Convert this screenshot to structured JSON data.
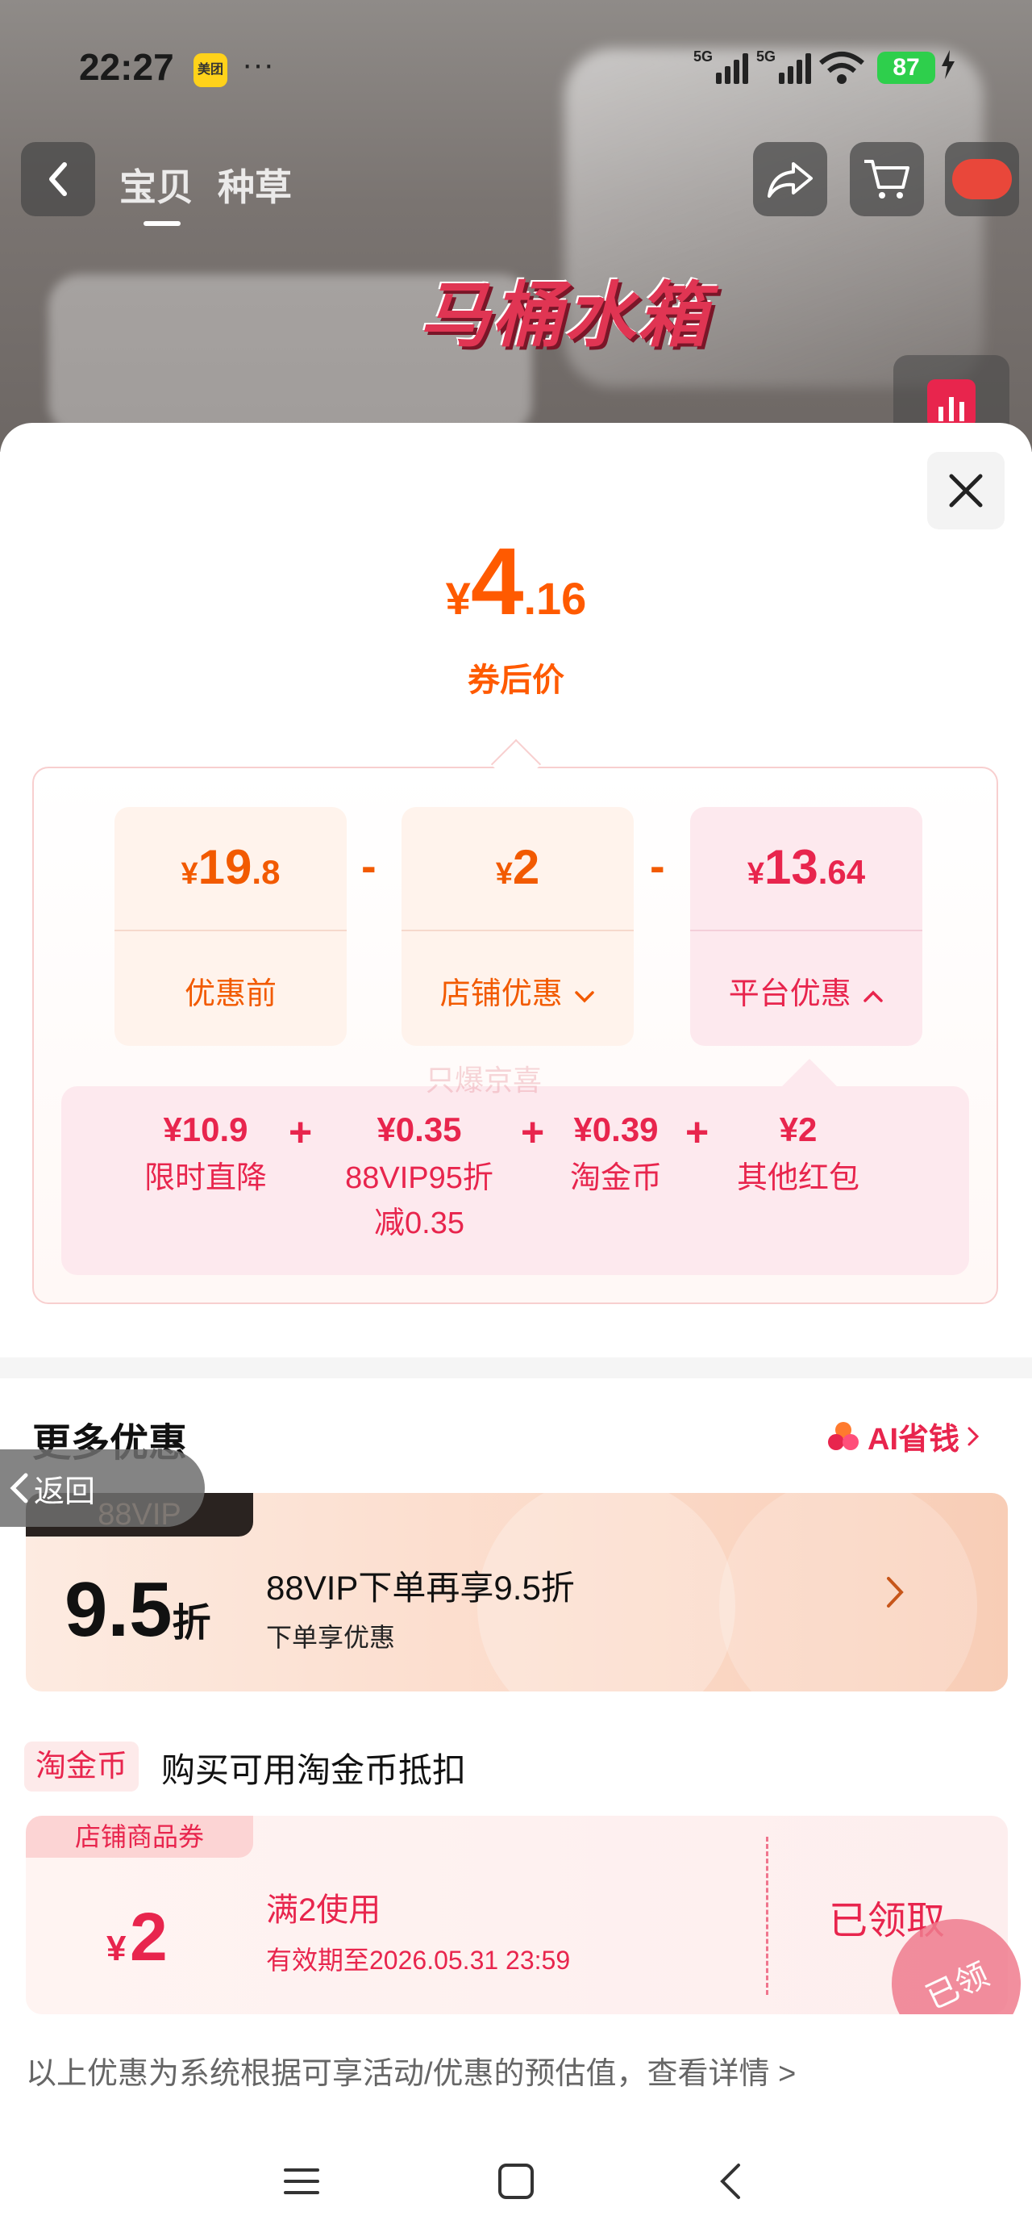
{
  "status_bar": {
    "time": "22:27",
    "app_badge": "美团",
    "dots": "···",
    "signal1_label": "5G",
    "signal2_label": "5G",
    "battery": "87"
  },
  "header": {
    "tabs": [
      "宝贝",
      "种草"
    ],
    "active_tab": "宝贝",
    "background_title": "马桶水箱"
  },
  "summary": {
    "currency": "¥",
    "price_int": "4",
    "price_dec": ".16",
    "label": "券后价"
  },
  "breakdown": [
    {
      "currency": "¥",
      "int": "19",
      "dec": ".8",
      "label": "优惠前"
    },
    {
      "currency": "¥",
      "int": "2",
      "dec": "",
      "label": "店铺优惠"
    },
    {
      "currency": "¥",
      "int": "13",
      "dec": ".64",
      "label": "平台优惠"
    }
  ],
  "operators": [
    "-",
    "-"
  ],
  "platform_details": [
    {
      "value": "¥10.9",
      "label": "限时直降"
    },
    {
      "value": "¥0.35",
      "label": "88VIP95折减0.35"
    },
    {
      "value": "¥0.39",
      "label": "淘金币"
    },
    {
      "value": "¥2",
      "label": "其他红包"
    }
  ],
  "detail_plus": [
    "+",
    "+",
    "+"
  ],
  "watermark": "只爆京喜",
  "more": {
    "title": "更多优惠",
    "ai_link": "AI省钱",
    "back_label": "返回"
  },
  "vip": {
    "tag": "88VIP",
    "discount_num": "9.5",
    "discount_unit": "折",
    "title": "88VIP下单再享9.5折",
    "subtitle": "下单享优惠"
  },
  "coin": {
    "tag": "淘金币",
    "text": "购买可用淘金币抵扣"
  },
  "coupon": {
    "tag": "店铺商品券",
    "currency": "¥",
    "amount": "2",
    "condition": "满2使用",
    "expiry": "有效期至2026.05.31 23:59",
    "state": "已领取",
    "stamp": "已领"
  },
  "disclaimer": "以上优惠为系统根据可享活动/优惠的预估值，查看详情 >",
  "colors": {
    "orange": "#ff5a00",
    "red": "#e8254d",
    "pink_bg": "#fde9ee",
    "orange_bg": "#fff3ec"
  }
}
